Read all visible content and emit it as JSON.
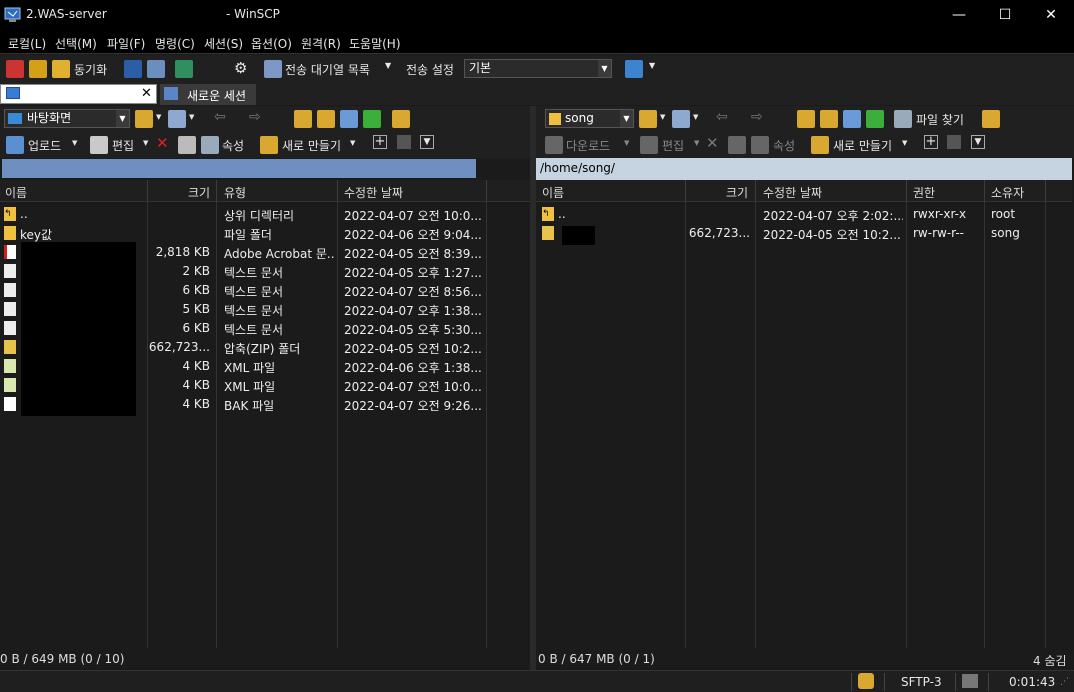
{
  "window": {
    "title_left": "2.WAS-server",
    "title_right": "- WinSCP",
    "minimize": "—",
    "maximize": "☐",
    "close": "✕"
  },
  "menu": [
    "로컬(L)",
    "선택(M)",
    "파일(F)",
    "명령(C)",
    "세션(S)",
    "옵션(O)",
    "원격(R)",
    "도움말(H)"
  ],
  "toolbar": {
    "sync_label": "동기화",
    "queue_label": "전송 대기열 목록",
    "transfer_settings_label": "전송 설정",
    "transfer_preset": "기본"
  },
  "tabs": {
    "current_close": "✕",
    "new_session": "새로운 세션"
  },
  "left": {
    "drive": "바탕화면",
    "upload": "업로드",
    "edit": "편집",
    "properties": "속성",
    "new": "새로 만들기",
    "path": "",
    "columns": [
      "이름",
      "크기",
      "유형",
      "수정한 날짜"
    ],
    "rows": [
      {
        "name": "..",
        "size": "",
        "type": "상위 디렉터리",
        "date": "2022-04-07  오전 10:0..."
      },
      {
        "name": "key값",
        "size": "",
        "type": "파일 폴더",
        "date": "2022-04-06  오전 9:04..."
      },
      {
        "name": "",
        "size": "2,818 KB",
        "type": "Adobe Acrobat 문...",
        "date": "2022-04-05  오전 8:39..."
      },
      {
        "name": "",
        "size": "2 KB",
        "type": "텍스트 문서",
        "date": "2022-04-05  오후 1:27..."
      },
      {
        "name": "",
        "size": "6 KB",
        "type": "텍스트 문서",
        "date": "2022-04-07  오전 8:56..."
      },
      {
        "name": "",
        "size": "5 KB",
        "type": "텍스트 문서",
        "date": "2022-04-07  오후 1:38..."
      },
      {
        "name": "",
        "size": "6 KB",
        "type": "텍스트 문서",
        "date": "2022-04-05  오후 5:30..."
      },
      {
        "name": "",
        "size": "662,723...",
        "type": "압축(ZIP) 폴더",
        "date": "2022-04-05  오전 10:2..."
      },
      {
        "name": "",
        "size": "4 KB",
        "type": "XML 파일",
        "date": "2022-04-06  오후 1:38..."
      },
      {
        "name": "",
        "size": "4 KB",
        "type": "XML 파일",
        "date": "2022-04-07  오전 10:0..."
      },
      {
        "name": "",
        "size": "4 KB",
        "type": "BAK 파일",
        "date": "2022-04-07  오전 9:26..."
      }
    ],
    "status": "0 B / 649 MB (0 / 10)"
  },
  "right": {
    "drive": "song",
    "find_files": "파일 찾기",
    "download": "다운로드",
    "edit": "편집",
    "properties": "속성",
    "new": "새로 만들기",
    "path": "/home/song/",
    "columns": [
      "이름",
      "크기",
      "수정한 날짜",
      "권한",
      "소유자"
    ],
    "rows": [
      {
        "name": "..",
        "size": "",
        "date": "2022-04-07  오후 2:02:...",
        "perm": "rwxr-xr-x",
        "owner": "root"
      },
      {
        "name": "",
        "size": "662,723...",
        "date": "2022-04-05  오전 10:2...",
        "perm": "rw-rw-r--",
        "owner": "song"
      }
    ],
    "status": "0 B / 647 MB (0 / 1)",
    "hidden": "4 숨김"
  },
  "statusbar": {
    "protocol": "SFTP-3",
    "time": "0:01:43"
  },
  "colors": {
    "accent_blue": "#6e8fc0",
    "path_active": "#c6d3e0",
    "folder": "#f0c040"
  }
}
